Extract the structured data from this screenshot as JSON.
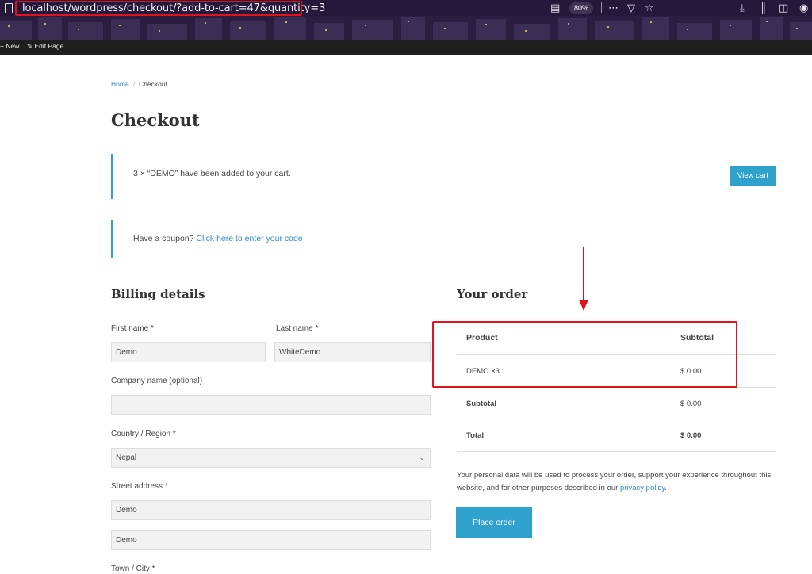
{
  "browser": {
    "url": "localhost/wordpress/checkout/?add-to-cart=47&quantity=3",
    "zoom": "80%",
    "icons": [
      "page-icon",
      "reader-view-icon",
      "more-icon",
      "pocket-icon",
      "star-icon",
      "download-icon",
      "library-icon",
      "sidebar-icon",
      "account-icon"
    ]
  },
  "admin_bar": {
    "new_label": "New",
    "edit_label": "Edit Page"
  },
  "breadcrumb": {
    "home": "Home",
    "current": "Checkout"
  },
  "page_title": "Checkout",
  "notices": {
    "cart_message": "3 × “DEMO” have been added to your cart.",
    "view_cart_label": "View cart",
    "coupon_prompt": "Have a coupon?",
    "coupon_link": "Click here to enter your code"
  },
  "billing": {
    "title": "Billing details",
    "first_name_label": "First name *",
    "first_name_value": "Demo",
    "last_name_label": "Last name *",
    "last_name_value": "WhiteDemo",
    "company_label": "Company name (optional)",
    "company_value": "",
    "country_label": "Country / Region *",
    "country_value": "Nepal",
    "street_label": "Street address *",
    "street_value_1": "Demo",
    "street_value_2": "Demo",
    "town_label": "Town / City *"
  },
  "order": {
    "title": "Your order",
    "col_product": "Product",
    "col_subtotal": "Subtotal",
    "item_name": "DEMO ×3",
    "item_subtotal": "$ 0.00",
    "subtotal_label": "Subtotal",
    "subtotal_value": "$ 0.00",
    "total_label": "Total",
    "total_value": "$ 0.00"
  },
  "privacy": {
    "text": "Your personal data will be used to process your order, support your experience throughout this website, and for other purposes described in our ",
    "link": "privacy policy",
    "end": "."
  },
  "place_order_label": "Place order",
  "colors": {
    "accent": "#2ea2cc",
    "annotation": "#e0121b",
    "browser_bg": "#26183a",
    "admin_bar_bg": "#1e1e1e"
  }
}
